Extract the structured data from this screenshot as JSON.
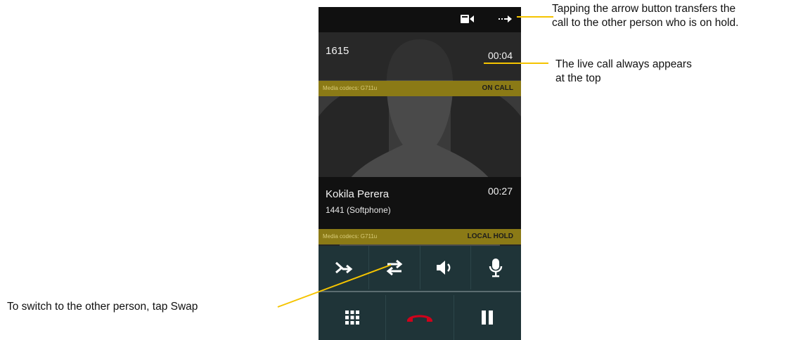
{
  "annotations": {
    "transfer": [
      "Tapping the arrow button transfers the",
      "call to the other person who is on hold."
    ],
    "live_call": [
      "The live call always appears",
      "at the top"
    ],
    "swap": "To switch to the other person, tap Swap"
  },
  "top_bar": {
    "icons": [
      "video-call-icon",
      "transfer-arrow-icon"
    ]
  },
  "active_call": {
    "number": "1615",
    "timer": "00:04",
    "codec": "Media codecs: G711u",
    "status": "ON CALL"
  },
  "held_call": {
    "name": "Kokila Perera",
    "detail": "1441 (Softphone)",
    "timer": "00:27",
    "codec": "Media codecs: G711u",
    "status": "LOCAL HOLD"
  },
  "controls": {
    "row1": [
      "merge-icon",
      "swap-icon",
      "speaker-icon",
      "microphone-icon"
    ],
    "row2": [
      "dialpad-icon",
      "end-call-icon",
      "pause-icon"
    ]
  },
  "colors": {
    "codec_bar": "#8b7a16",
    "controls_bg": "#1f3438",
    "end_call": "#d0021b",
    "annotation_line": "#f5c400"
  }
}
